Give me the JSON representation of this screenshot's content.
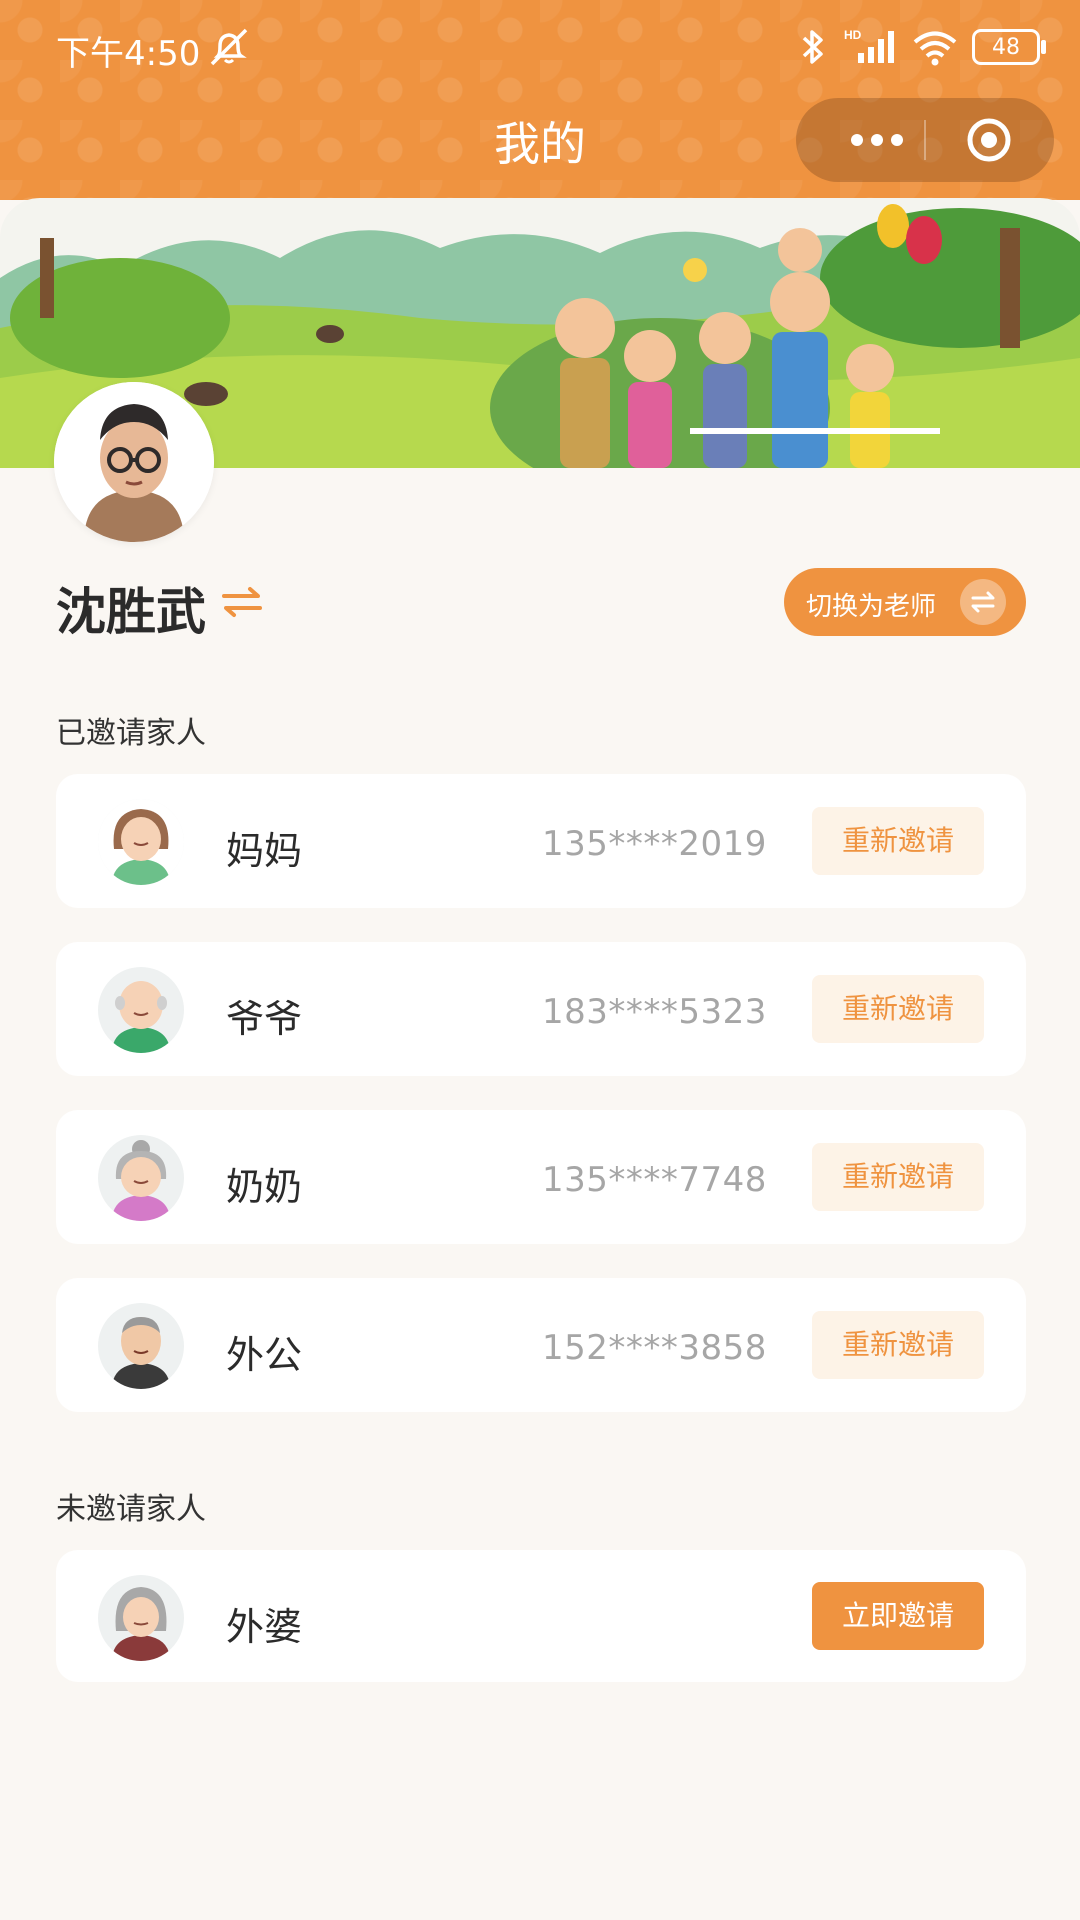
{
  "status_bar": {
    "time": "下午4:50",
    "battery": "48",
    "icons": [
      "mute-icon",
      "bluetooth-icon",
      "signal-icon",
      "wifi-icon",
      "battery-icon"
    ]
  },
  "header": {
    "title": "我的",
    "capsule_icons": [
      "more-dots-icon",
      "target-icon"
    ],
    "background_color": "#ef9340"
  },
  "profile": {
    "name": "沈胜武",
    "switch_role_label": "切换为老师"
  },
  "invited_section": {
    "title": "已邀请家人",
    "members": [
      {
        "name": "妈妈",
        "phone": "135****2019",
        "action": "重新邀请"
      },
      {
        "name": "爷爷",
        "phone": "183****5323",
        "action": "重新邀请"
      },
      {
        "name": "奶奶",
        "phone": "135****7748",
        "action": "重新邀请"
      },
      {
        "name": "外公",
        "phone": "152****3858",
        "action": "重新邀请"
      }
    ]
  },
  "uninvited_section": {
    "title": "未邀请家人",
    "members": [
      {
        "name": "外婆",
        "action": "立即邀请"
      }
    ]
  },
  "colors": {
    "accent": "#ef9340",
    "accent_light": "#fdf3e7",
    "background": "#faf7f3"
  }
}
